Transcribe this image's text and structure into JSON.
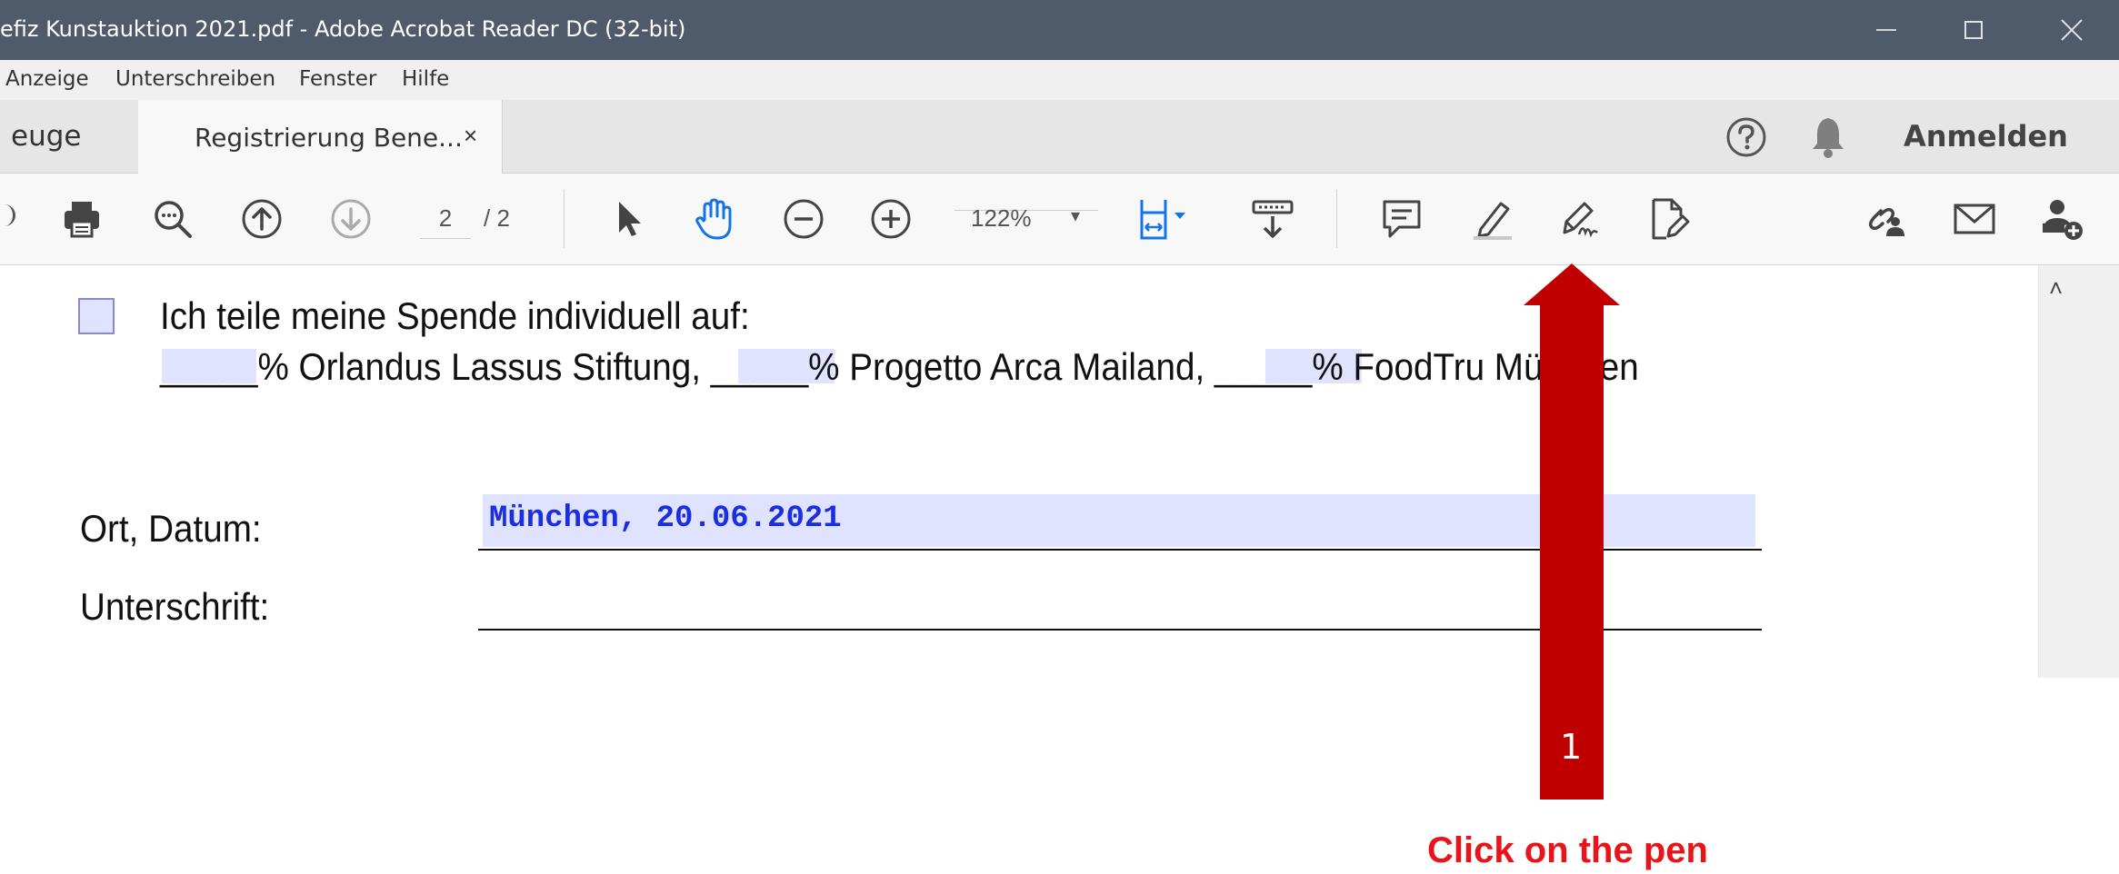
{
  "window": {
    "title": "efiz Kunstauktion 2021.pdf - Adobe Acrobat Reader DC (32-bit)",
    "controls": {
      "minimize": "—",
      "maximize": "☐",
      "close": "✕"
    }
  },
  "menu": {
    "items": [
      "Anzeige",
      "Unterschreiben",
      "Fenster",
      "Hilfe"
    ]
  },
  "tabs": {
    "tools_label": "euge",
    "document_label": "Registrierung Bene...",
    "document_close": "×",
    "sign_in": "Anmelden"
  },
  "toolbar": {
    "page_current": "2",
    "page_total": "/ 2",
    "zoom": "122%",
    "zoom_caret": "▾",
    "icons": [
      "print-icon",
      "zoom-search-icon",
      "page-up-icon",
      "page-down-icon",
      "select-arrow-icon",
      "hand-icon",
      "zoom-out-icon",
      "zoom-in-icon",
      "fit-page-icon",
      "scroll-mode-icon",
      "comment-icon",
      "highlight-icon",
      "fill-sign-pen-icon",
      "edit-pdf-icon",
      "share-link-icon",
      "email-icon",
      "add-user-icon"
    ]
  },
  "document": {
    "checkbox_label": "Ich teile meine Spende individuell auf:",
    "split_line": "_____% Orlandus Lassus Stiftung, _____% Progetto Arca Mailand, _____% FoodTru      München",
    "ort_label": "Ort, Datum:",
    "date_value": "München, 20.06.2021",
    "signature_label": "Unterschrift:",
    "scroll_up": "˄"
  },
  "annotation": {
    "step_number": "1",
    "instruction": "Click on the pen",
    "arrow_color": "#c00000",
    "instruction_color": "#e8141a"
  },
  "colors": {
    "titlebar": "#4f5a6a",
    "form_field": "#dfe3ff",
    "field_text": "#1c2fe0",
    "hand_tool": "#1473e6"
  }
}
